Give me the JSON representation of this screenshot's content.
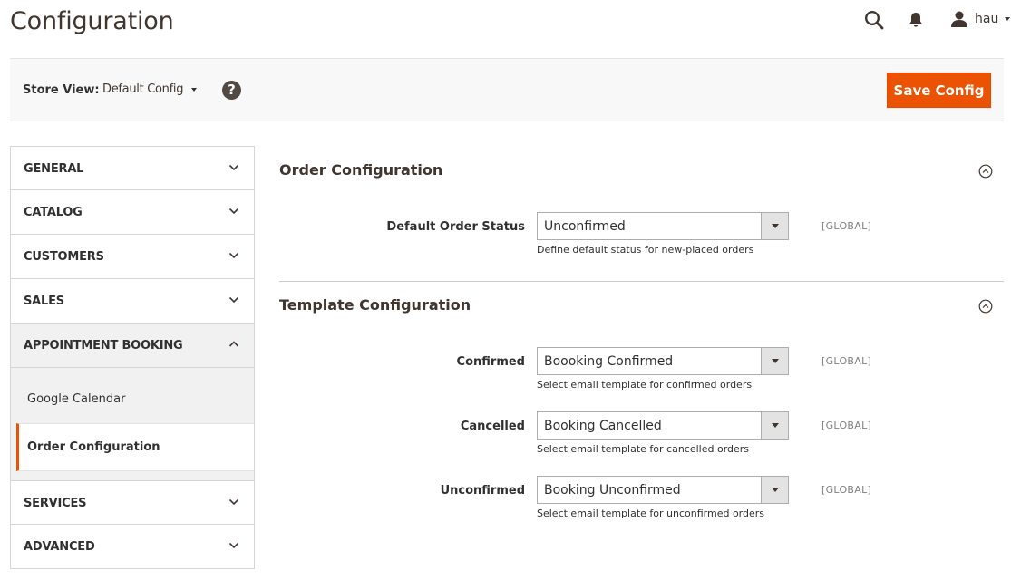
{
  "header": {
    "title": "Configuration",
    "user_name": "hau"
  },
  "store_bar": {
    "label": "Store View:",
    "selected": "Default Config",
    "help_glyph": "?",
    "save_label": "Save Config"
  },
  "colors": {
    "accent": "#eb5202",
    "text": "#303030",
    "heading": "#41362f"
  },
  "sidebar": {
    "items": [
      {
        "label": "GENERAL"
      },
      {
        "label": "CATALOG"
      },
      {
        "label": "CUSTOMERS"
      },
      {
        "label": "SALES"
      },
      {
        "label": "APPOINTMENT BOOKING"
      },
      {
        "label": "SERVICES"
      },
      {
        "label": "ADVANCED"
      }
    ],
    "sub_items": [
      {
        "label": "Google Calendar"
      },
      {
        "label": "Order Configuration"
      }
    ]
  },
  "sections": {
    "order": {
      "title": "Order Configuration",
      "fields": [
        {
          "label": "Default Order Status",
          "value": "Unconfirmed",
          "note": "Define default status for new-placed orders",
          "scope": "[GLOBAL]"
        }
      ]
    },
    "template": {
      "title": "Template Configuration",
      "fields": [
        {
          "label": "Confirmed",
          "value": "Boooking Confirmed",
          "note": "Select email template for confirmed orders",
          "scope": "[GLOBAL]"
        },
        {
          "label": "Cancelled",
          "value": "Booking Cancelled",
          "note": "Select email template for cancelled orders",
          "scope": "[GLOBAL]"
        },
        {
          "label": "Unconfirmed",
          "value": "Booking Unconfirmed",
          "note": "Select email template for unconfirmed orders",
          "scope": "[GLOBAL]"
        }
      ]
    }
  }
}
